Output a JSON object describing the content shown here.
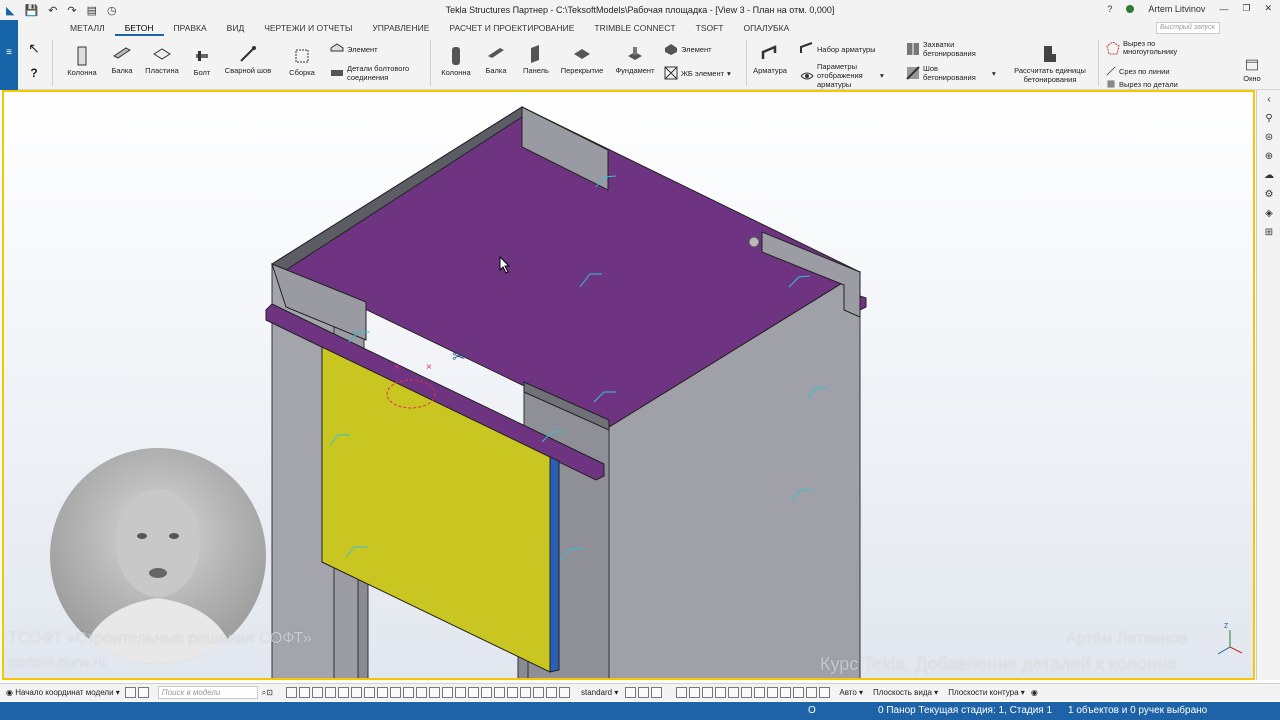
{
  "titlebar": {
    "title": "Tekla Structures Партнер - C:\\TeksoftModels\\Рабочая площадка - [View 3 - План на отм. 0,000]",
    "user": "Artem Litvinov",
    "quick_search_placeholder": "Быстрый запуск"
  },
  "menu": {
    "tabs": [
      "МЕТАЛЛ",
      "БЕТОН",
      "ПРАВКА",
      "ВИД",
      "ЧЕРТЕЖИ И ОТЧЕТЫ",
      "УПРАВЛЕНИЕ",
      "РАСЧЕТ И ПРОЕКТИРОВАНИЕ",
      "TRIMBLE CONNECT",
      "TSOFT",
      "ОПАЛУБКА"
    ],
    "active": "БЕТОН"
  },
  "ribbon": {
    "steel": {
      "column": "Колонна",
      "beam": "Балка",
      "plate": "Пластина",
      "bolt": "Болт",
      "weld": "Сварной шов",
      "assembly": "Сборка",
      "element": "Элемент",
      "bolt_parts": "Детали болтового соединения"
    },
    "concrete": {
      "column": "Колонна",
      "beam": "Балка",
      "panel": "Панель",
      "slab": "Перекрытие",
      "footing": "Фундамент",
      "element": "Элемент",
      "rc_element": "ЖБ элемент",
      "rebar": "Арматура",
      "rebar_set": "Набор арматуры",
      "rebar_props": "Параметры отображения арматуры",
      "pour_breaks": "Захватки бетонирования",
      "pour_seam": "Шов бетонирования",
      "calc_pour": "Рассчитать единицы бетонирования"
    },
    "edit": {
      "polygon_cut": "Вырез по многоугольнику",
      "line_cut": "Срез по линии",
      "part_cut": "Вырез по детали",
      "window": "Окно"
    }
  },
  "bottombar": {
    "origin": "Начало координат модели",
    "search_placeholder": "Поиск в модели",
    "standard": "standard",
    "auto": "Авто",
    "view_plane": "Плоскость вида",
    "contour_plane": "Плоскости контура"
  },
  "statusbar": {
    "o": "O",
    "stage": "0  Панор Текущая стадия: 1, Стадия 1",
    "selection": "1 объектов и 0 ручек выбрано"
  },
  "watermarks": {
    "left_line1": "ТСОФТ «Строительные решения СОФТ»",
    "left_line2": "tsoftsolutions.ru",
    "right_line1": "Артём Литвинов",
    "right_line2": "Курс Tekla. Добавление деталей к колонне"
  }
}
